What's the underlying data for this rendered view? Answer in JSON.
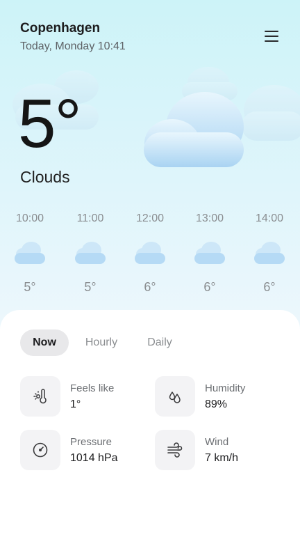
{
  "header": {
    "city": "Copenhagen",
    "datetime": "Today, Monday 10:41",
    "menu_icon": "hamburger-menu-icon"
  },
  "current": {
    "temperature": "5°",
    "condition": "Clouds",
    "icon": "cloud-icon"
  },
  "hourly": [
    {
      "time": "10:00",
      "temp": "5°",
      "icon": "cloud-icon"
    },
    {
      "time": "11:00",
      "temp": "5°",
      "icon": "cloud-icon"
    },
    {
      "time": "12:00",
      "temp": "6°",
      "icon": "cloud-icon"
    },
    {
      "time": "13:00",
      "temp": "6°",
      "icon": "cloud-icon"
    },
    {
      "time": "14:00",
      "temp": "6°",
      "icon": "cloud-icon"
    }
  ],
  "tabs": [
    {
      "label": "Now",
      "active": true
    },
    {
      "label": "Hourly",
      "active": false
    },
    {
      "label": "Daily",
      "active": false
    }
  ],
  "metrics": {
    "feels_like": {
      "label": "Feels like",
      "value": "1°",
      "icon": "thermometer-sun-icon"
    },
    "humidity": {
      "label": "Humidity",
      "value": "89%",
      "icon": "droplets-icon"
    },
    "pressure": {
      "label": "Pressure",
      "value": "1014 hPa",
      "icon": "gauge-icon"
    },
    "wind": {
      "label": "Wind",
      "value": "7 km/h",
      "icon": "wind-icon"
    }
  },
  "colors": {
    "cloud": "#b9dcf5",
    "background_top": "#cdf3f8",
    "active_tab_bg": "#e8e8ea",
    "tile_bg": "#f3f3f5"
  }
}
